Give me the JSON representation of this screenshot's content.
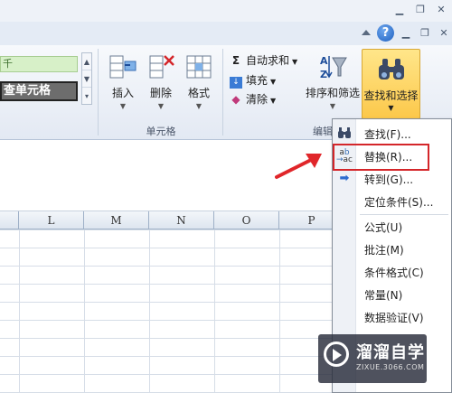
{
  "window": {
    "min_glyph": "▁",
    "restore_glyph": "❐",
    "close_glyph": "✕",
    "help_glyph": "?"
  },
  "styles": {
    "green_text": "千",
    "check_text": "查单元格"
  },
  "cells_group": {
    "label": "单元格",
    "insert": "插入",
    "delete": "删除",
    "format": "格式"
  },
  "editing_group": {
    "label": "编辑",
    "autosum": "自动求和",
    "fill": "填充",
    "clear": "清除",
    "sort_filter": "排序和筛选",
    "find_select": "查找和选择"
  },
  "columns": [
    "L",
    "M",
    "N",
    "O",
    "P"
  ],
  "menu": {
    "items": [
      {
        "label": "查找(F)...",
        "icon": "binoculars-icon"
      },
      {
        "label": "替换(R)...",
        "icon": "replace-icon"
      },
      {
        "label": "转到(G)...",
        "icon": "arrow-icon"
      },
      {
        "label": "定位条件(S)...",
        "icon": ""
      },
      {
        "label": "公式(U)",
        "icon": ""
      },
      {
        "label": "批注(M)",
        "icon": ""
      },
      {
        "label": "条件格式(C)",
        "icon": ""
      },
      {
        "label": "常量(N)",
        "icon": ""
      },
      {
        "label": "数据验证(V)",
        "icon": ""
      }
    ]
  },
  "watermark": {
    "title": "溜溜自学",
    "url": "ZIXUE.3066.COM"
  },
  "colors": {
    "accent_highlight": "#d4262a",
    "find_button": "#fcc84a"
  }
}
